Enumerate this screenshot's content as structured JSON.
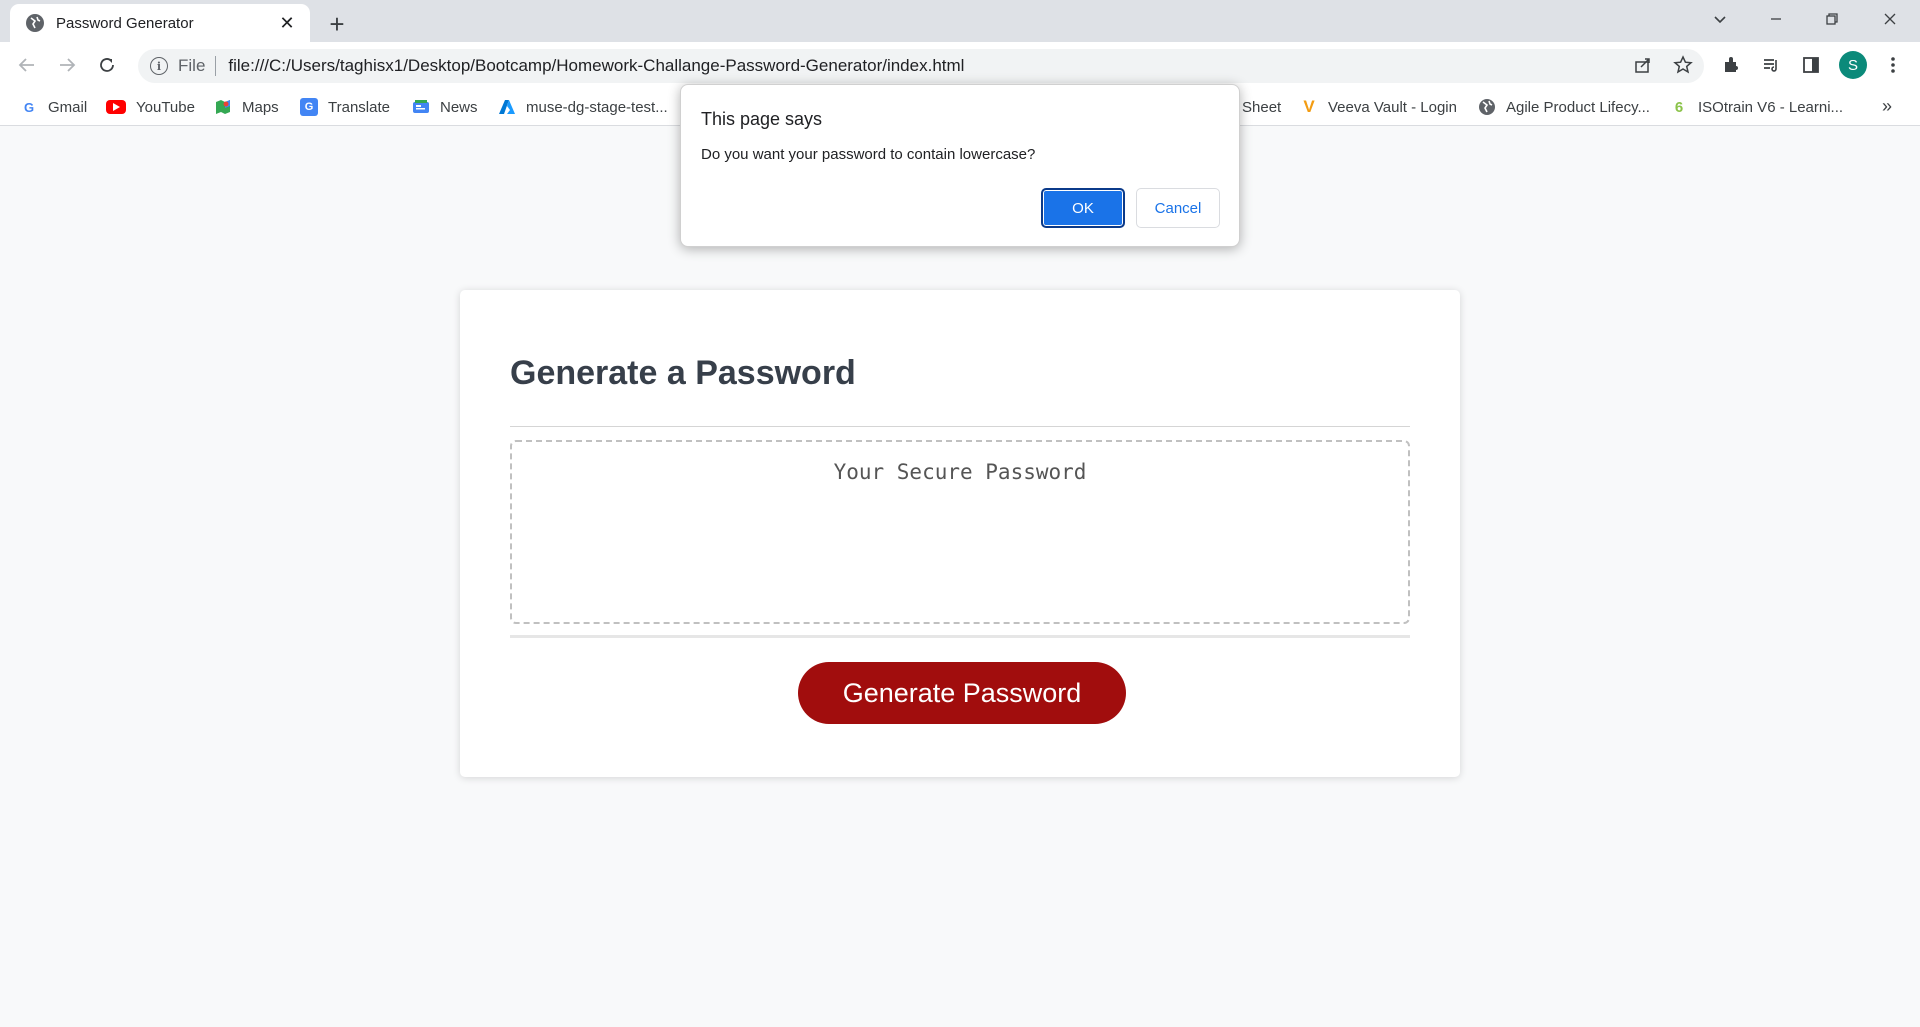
{
  "browser": {
    "tab": {
      "title": "Password Generator",
      "close_glyph": "✕"
    },
    "new_tab_glyph": "+",
    "address": {
      "scheme_label": "File",
      "url": "file:///C:/Users/taghisx1/Desktop/Bootcamp/Homework-Challange-Password-Generator/index.html"
    },
    "profile_initial": "S",
    "colors": {
      "tabstrip": "#dee1e6",
      "profile": "#0b8a7a",
      "accent": "#1a73e8"
    }
  },
  "bookmarks": {
    "items": [
      {
        "label": "Gmail",
        "icon": "google-icon"
      },
      {
        "label": "YouTube",
        "icon": "youtube-icon"
      },
      {
        "label": "Maps",
        "icon": "maps-icon"
      },
      {
        "label": "Translate",
        "icon": "translate-icon"
      },
      {
        "label": "News",
        "icon": "news-icon"
      },
      {
        "label": "muse-dg-stage-test...",
        "icon": "azure-icon"
      },
      {
        "label": "Sheet",
        "icon": "sheet-icon"
      },
      {
        "label": "Veeva Vault - Login",
        "icon": "veeva-icon"
      },
      {
        "label": "Agile Product Lifecy...",
        "icon": "globe-icon"
      },
      {
        "label": "ISOtrain V6 - Learni...",
        "icon": "isotrain-icon"
      }
    ],
    "more_glyph": "»"
  },
  "dialog": {
    "title": "This page says",
    "message": "Do you want your password to contain lowercase?",
    "ok_label": "OK",
    "cancel_label": "Cancel"
  },
  "app": {
    "title": "Generate a Password",
    "password_placeholder": "Your Secure Password",
    "generate_label": "Generate Password",
    "colors": {
      "button": "#a10d0d",
      "heading": "#373f4a"
    }
  }
}
